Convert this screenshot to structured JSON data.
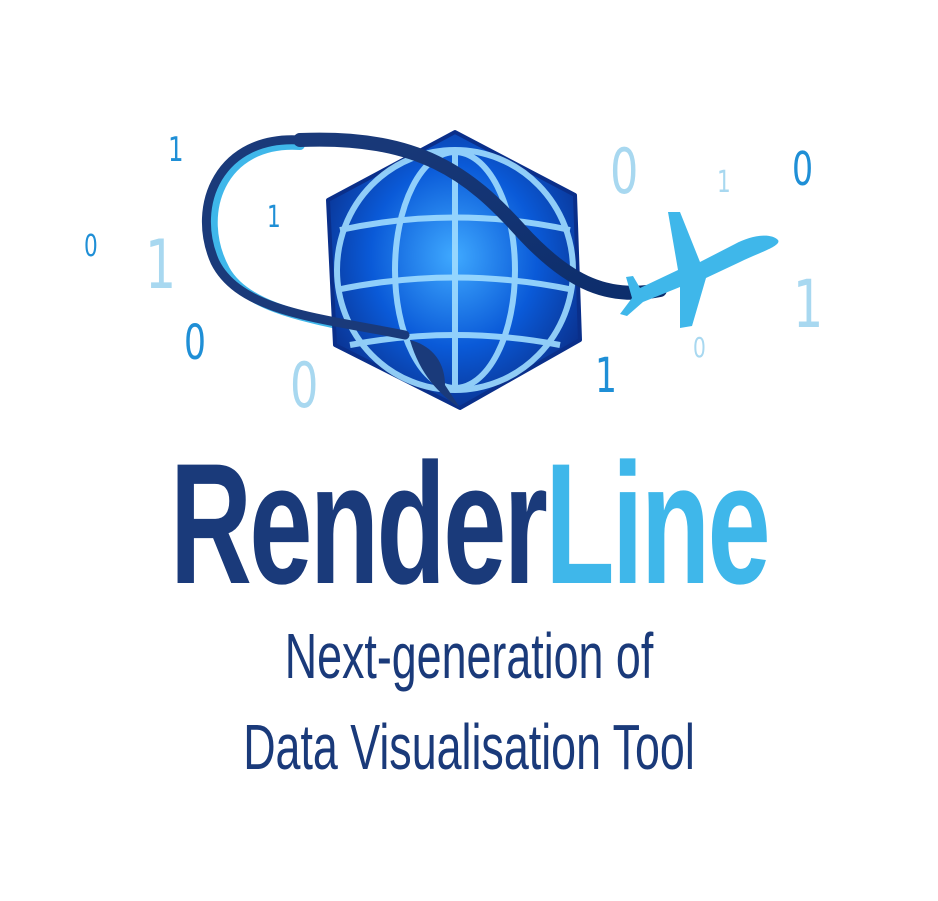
{
  "logo": {
    "name_part1": "Render",
    "name_part2": "Line",
    "tagline_line1": "Next-generation of",
    "tagline_line2": "Data Visualisation Tool",
    "icons": [
      "hexagon-globe-icon",
      "airplane-icon",
      "ribbon-trail-icon"
    ],
    "binary_digits": [
      "1",
      "0",
      "1",
      "1",
      "0",
      "0",
      "0",
      "1",
      "0",
      "1",
      "1",
      "0"
    ],
    "colors": {
      "dark_blue": "#1a3a7a",
      "light_blue": "#3fb7ea",
      "pale_blue": "#a8d8f0",
      "mid_blue": "#1f8fd6",
      "globe_blue": "#0a4fbf",
      "background": "#ffffff"
    }
  }
}
